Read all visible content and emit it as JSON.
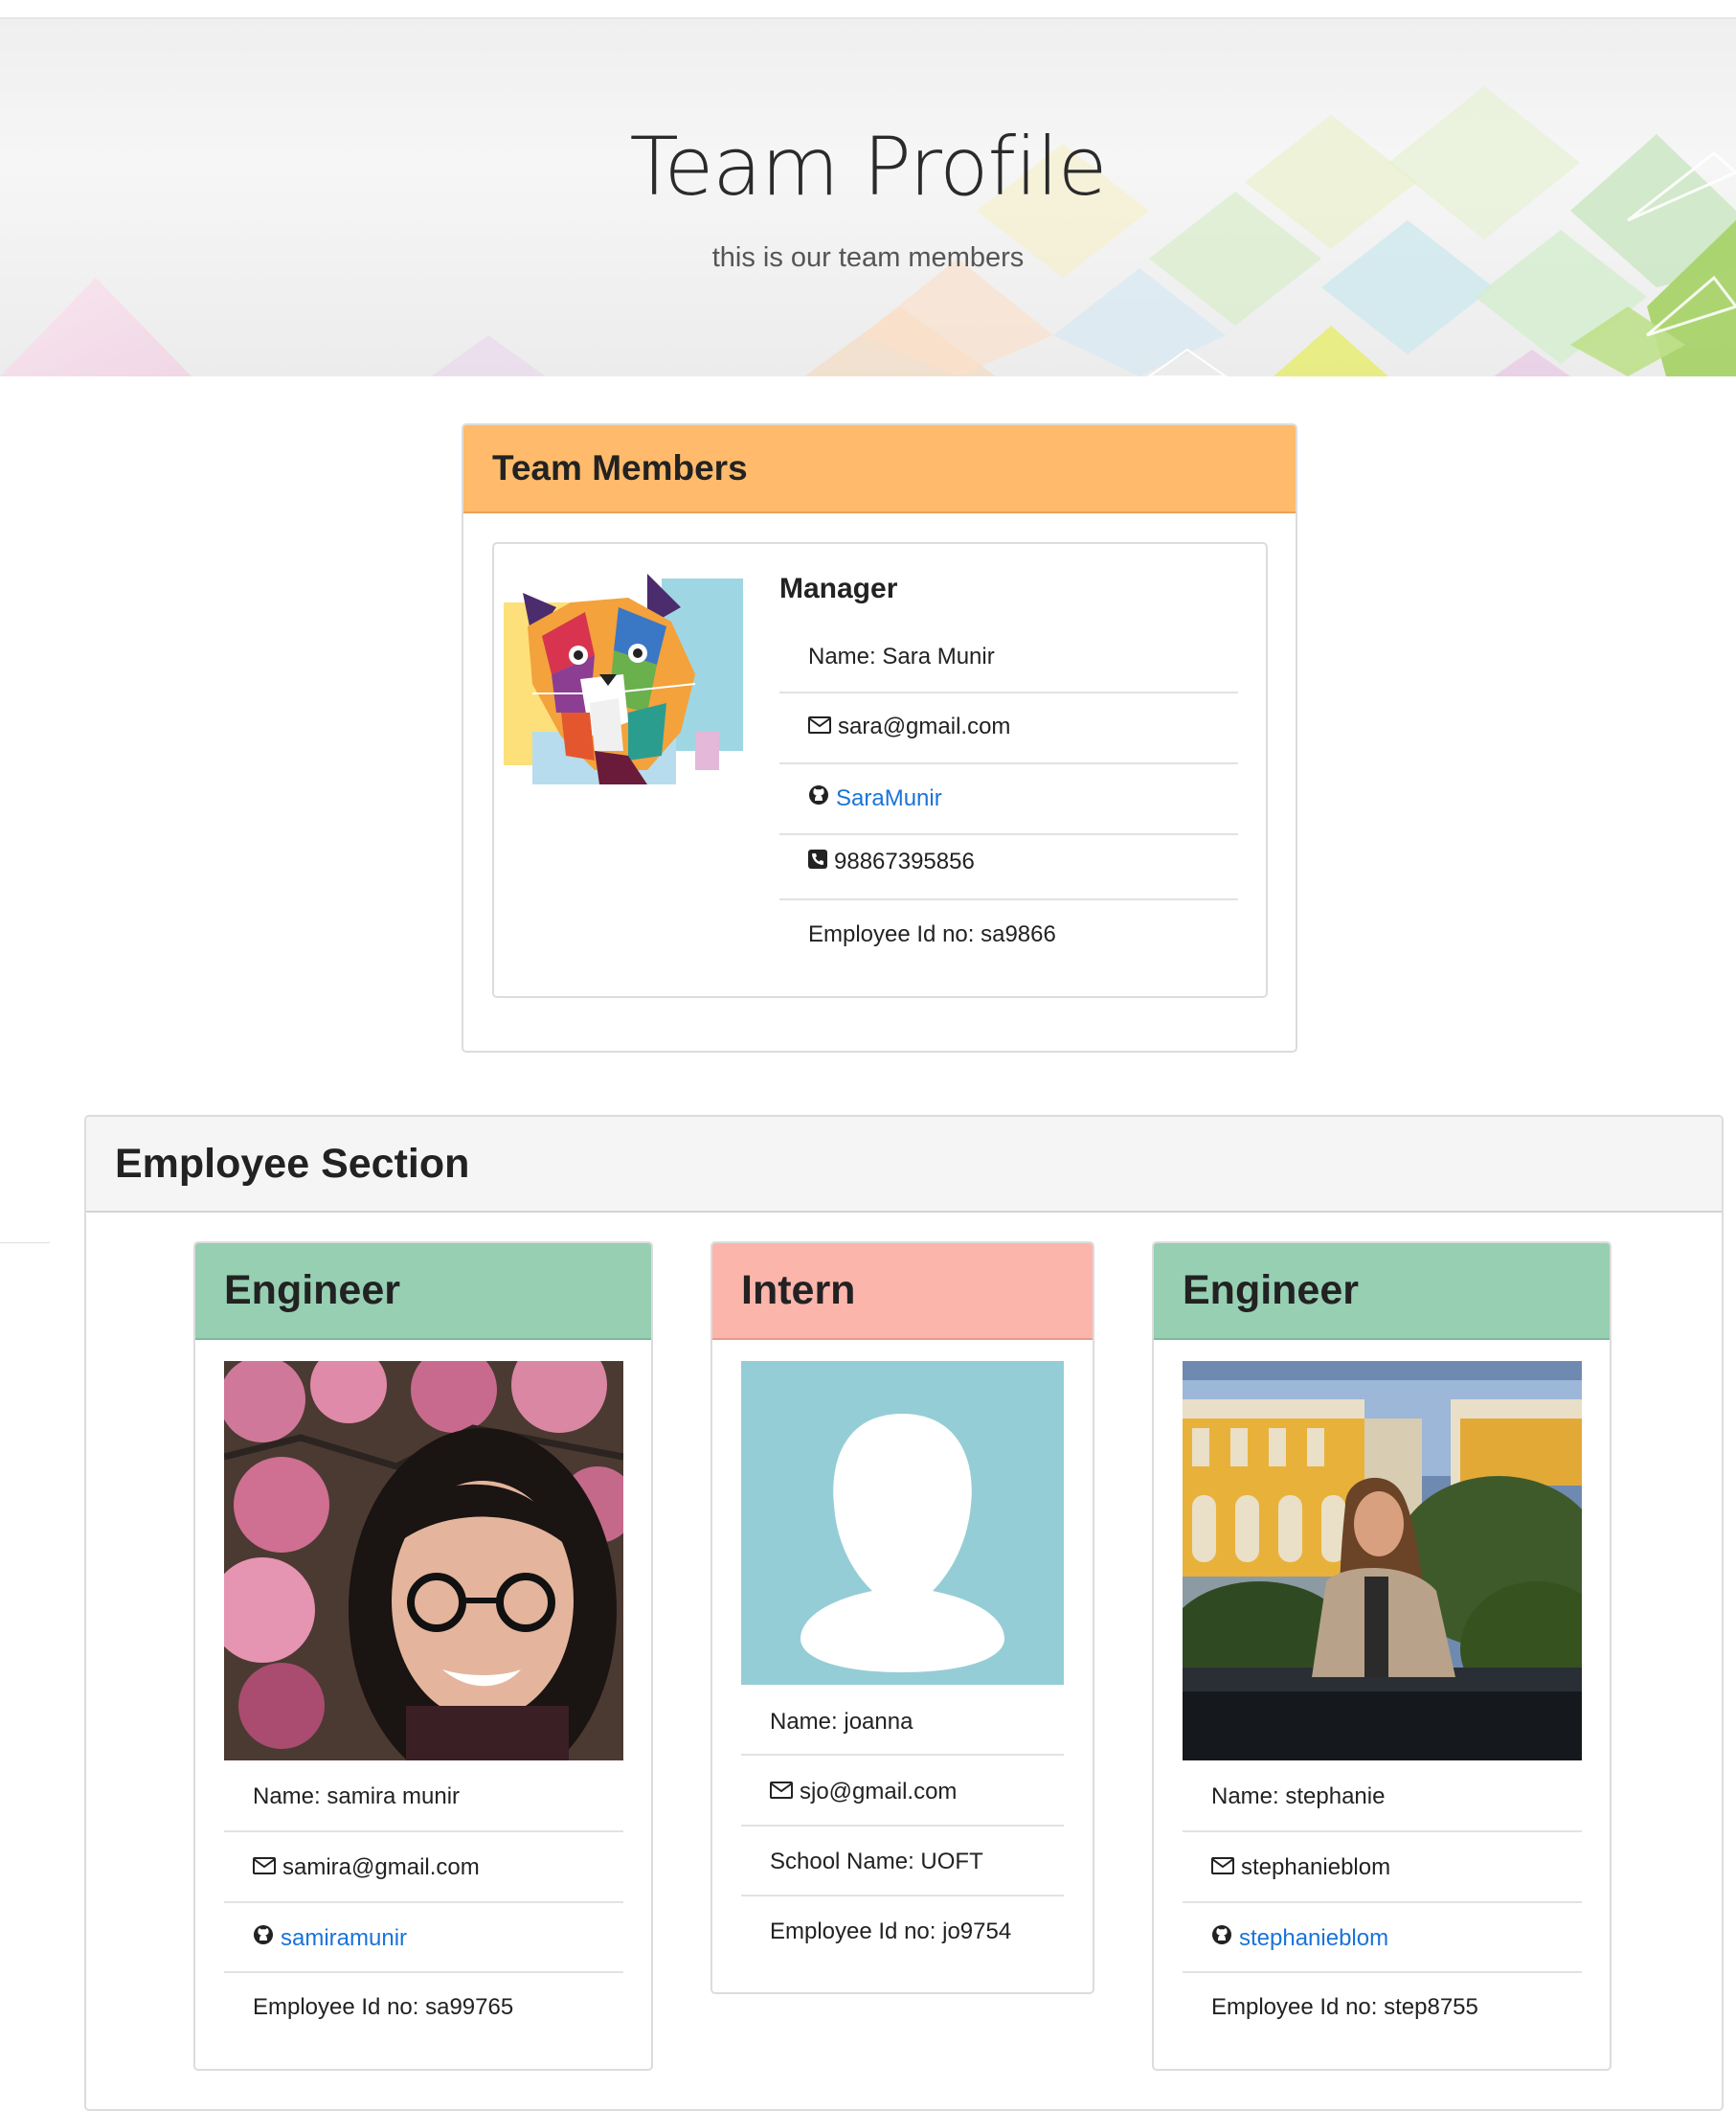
{
  "hero": {
    "title": "Team Profile",
    "subtitle": "this is our team members"
  },
  "team": {
    "header": "Team Members",
    "manager": {
      "role": "Manager",
      "name": "Name: Sara Munir",
      "email": "sara@gmail.com",
      "github": "SaraMunir",
      "phone": "98867395856",
      "employee_id": "Employee Id no: sa9866"
    }
  },
  "employees": {
    "header": "Employee Section",
    "cards": [
      {
        "role": "Engineer",
        "name": "Name: samira munir",
        "email": "samira@gmail.com",
        "github": "samiramunir",
        "employee_id": "Employee Id no: sa99765"
      },
      {
        "role": "Intern",
        "name": "Name: joanna",
        "email": "sjo@gmail.com",
        "school": "School Name: UOFT",
        "employee_id": "Employee Id no: jo9754"
      },
      {
        "role": "Engineer",
        "name": "Name: stephanie",
        "email": "stephanieblom",
        "github": "stephanieblom",
        "employee_id": "Employee Id no: step8755"
      }
    ]
  },
  "colors": {
    "team_header": "#ffbb6b",
    "engineer_header": "#97cfb2",
    "intern_header": "#fcb5ab",
    "link": "#1a73d9"
  },
  "icons": [
    "envelope-icon",
    "github-icon",
    "phone-icon",
    "avatar-placeholder-icon"
  ]
}
